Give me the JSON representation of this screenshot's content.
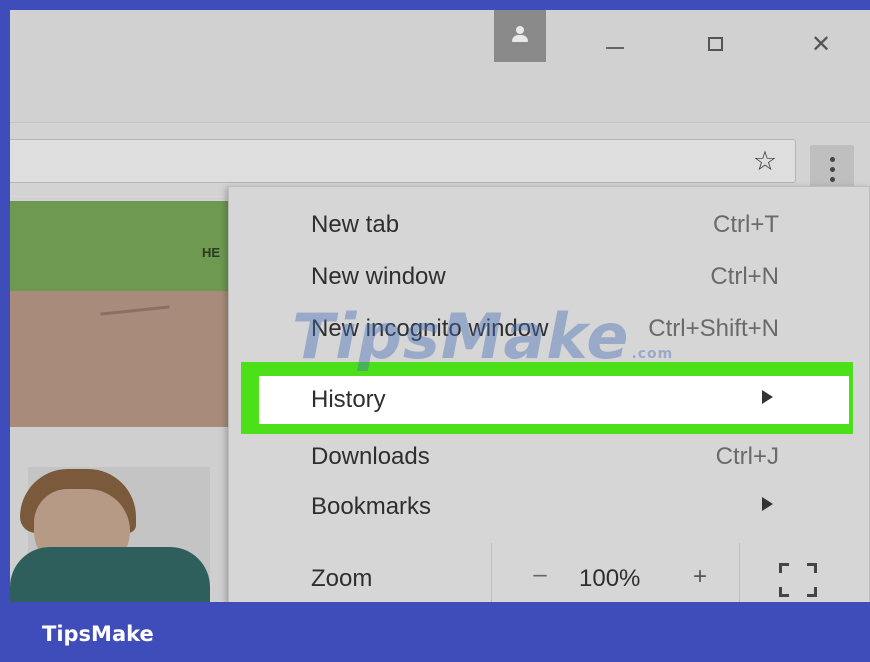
{
  "window": {
    "controls": {
      "profile_icon": "person-icon",
      "minimize_icon": "minimize-icon",
      "maximize_icon": "maximize-icon",
      "close_label": "✕"
    }
  },
  "toolbar": {
    "bookmark_star": "☆",
    "menu_icon": "three-dots-vertical-icon"
  },
  "page": {
    "banner_text": "HE"
  },
  "menu": {
    "items": [
      {
        "label": "New tab",
        "shortcut": "Ctrl+T"
      },
      {
        "label": "New window",
        "shortcut": "Ctrl+N"
      },
      {
        "label": "New incognito window",
        "shortcut": "Ctrl+Shift+N"
      },
      {
        "label": "History",
        "submenu": true
      },
      {
        "label": "Downloads",
        "shortcut": "Ctrl+J"
      },
      {
        "label": "Bookmarks",
        "submenu": true
      }
    ],
    "zoom": {
      "label": "Zoom",
      "minus": "–",
      "value": "100%",
      "plus": "+",
      "fullscreen_icon": "fullscreen-icon"
    },
    "highlight_color": "#4ce01a"
  },
  "watermark": {
    "text": "TipsMake",
    "suffix": ".com"
  },
  "footer": {
    "brand": "TipsMake",
    "color": "#3f4dbb"
  }
}
